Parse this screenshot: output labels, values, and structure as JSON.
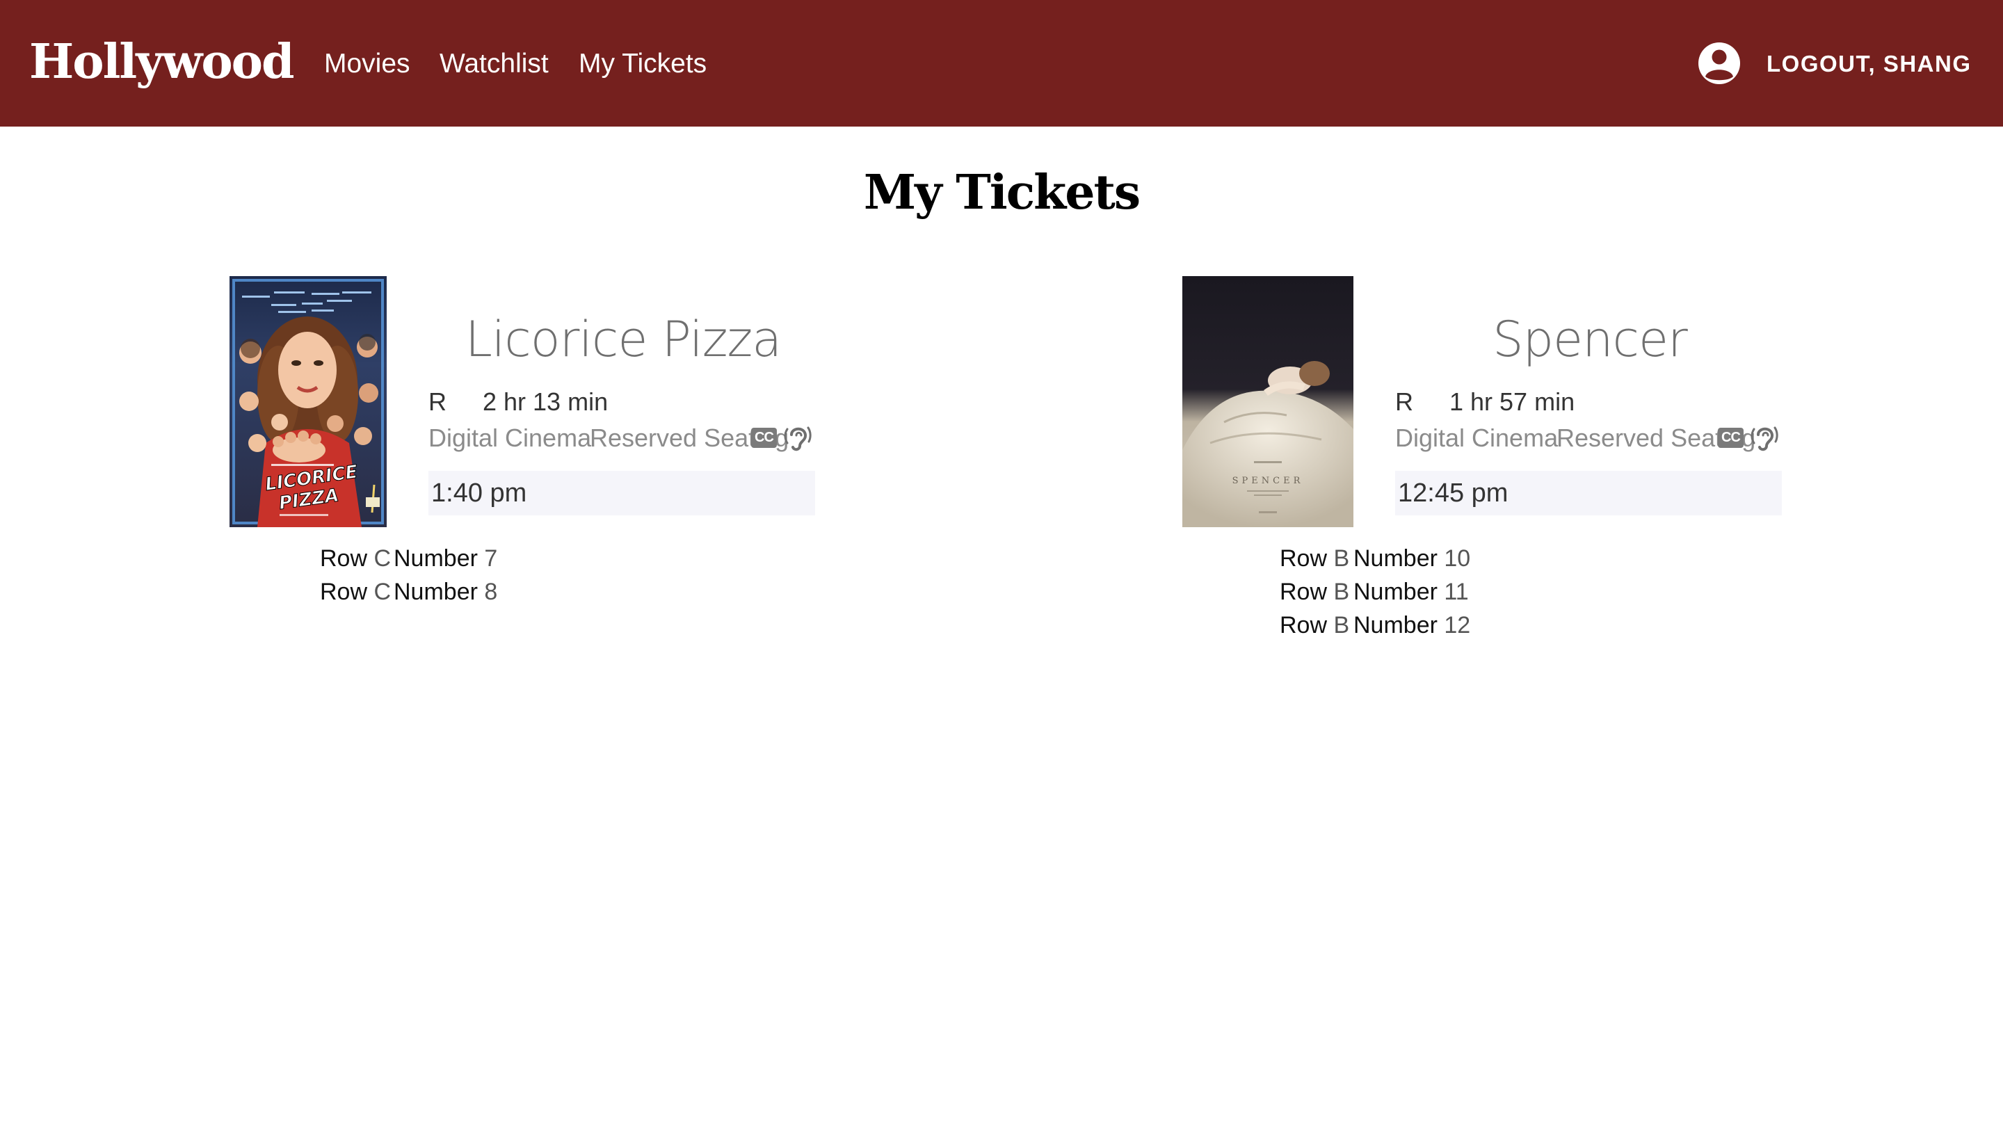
{
  "header": {
    "logo": "Hollywood",
    "nav": [
      "Movies",
      "Watchlist",
      "My Tickets"
    ],
    "logout_label": "LOGOUT, SHANG",
    "background_color": "#75201e"
  },
  "page": {
    "title": "My Tickets"
  },
  "tickets": [
    {
      "title": "Licorice Pizza",
      "rating": "R",
      "runtime": "2 hr 13 min",
      "format": "Digital Cinema",
      "seating": "Reserved Seating",
      "accessibility_icons": [
        "closed-captions-icon",
        "assistive-listening-icon"
      ],
      "showtime": "1:40 pm",
      "poster_text": [
        "LICORICE",
        "PIZZA"
      ],
      "seats": [
        {
          "row_label": "Row",
          "row": "C",
          "number_label": "Number",
          "number": "7"
        },
        {
          "row_label": "Row",
          "row": "C",
          "number_label": "Number",
          "number": "8"
        }
      ]
    },
    {
      "title": "Spencer",
      "rating": "R",
      "runtime": "1 hr 57 min",
      "format": "Digital Cinema",
      "seating": "Reserved Seating",
      "accessibility_icons": [
        "closed-captions-icon",
        "assistive-listening-icon"
      ],
      "showtime": "12:45 pm",
      "poster_text": [
        "SPENCER"
      ],
      "seats": [
        {
          "row_label": "Row",
          "row": "B",
          "number_label": "Number",
          "number": "10"
        },
        {
          "row_label": "Row",
          "row": "B",
          "number_label": "Number",
          "number": "11"
        },
        {
          "row_label": "Row",
          "row": "B",
          "number_label": "Number",
          "number": "12"
        }
      ]
    }
  ],
  "icons": {
    "cc_text": "CC"
  }
}
